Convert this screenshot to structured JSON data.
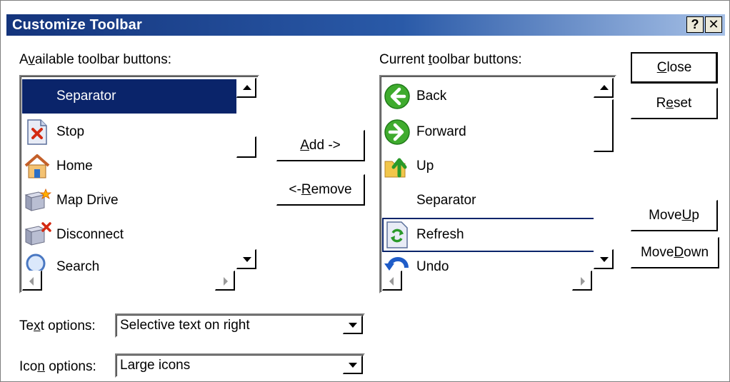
{
  "window": {
    "title": "Customize Toolbar",
    "help_label": "?",
    "close_label": "✕"
  },
  "available": {
    "label_pre": "A",
    "label_mnemonic": "v",
    "label_post": "ailable toolbar buttons:",
    "items": [
      {
        "label": "Separator",
        "icon": "none",
        "selected": true
      },
      {
        "label": "Stop",
        "icon": "stop-icon"
      },
      {
        "label": "Home",
        "icon": "home-icon"
      },
      {
        "label": "Map Drive",
        "icon": "map-drive-icon"
      },
      {
        "label": "Disconnect",
        "icon": "disconnect-icon"
      },
      {
        "label": "Search",
        "icon": "search-icon"
      }
    ]
  },
  "current": {
    "label_pre": "Current ",
    "label_mnemonic": "t",
    "label_post": "oolbar buttons:",
    "items": [
      {
        "label": "Back",
        "icon": "back-icon"
      },
      {
        "label": "Forward",
        "icon": "forward-icon"
      },
      {
        "label": "Up",
        "icon": "up-folder-icon"
      },
      {
        "label": "Separator",
        "icon": "none"
      },
      {
        "label": "Refresh",
        "icon": "refresh-icon",
        "focused": true
      },
      {
        "label": "Undo",
        "icon": "undo-icon"
      }
    ]
  },
  "buttons": {
    "add": {
      "mnemonic": "A",
      "rest": "dd ->"
    },
    "remove": {
      "pre": "<- ",
      "mnemonic": "R",
      "rest": "emove"
    },
    "close": {
      "mnemonic": "C",
      "rest": "lose"
    },
    "reset": {
      "pre": "R",
      "mnemonic": "e",
      "rest": "set"
    },
    "move_up": {
      "pre": "Move ",
      "mnemonic": "U",
      "rest": "p"
    },
    "move_down": {
      "pre": "Move ",
      "mnemonic": "D",
      "rest": "own"
    }
  },
  "text_options": {
    "label_pre": "Te",
    "label_mnemonic": "x",
    "label_post": "t options:",
    "value": "Selective text on right"
  },
  "icon_options": {
    "label_pre": "Ico",
    "label_mnemonic": "n",
    "label_post": " options:",
    "value": "Large icons"
  },
  "colors": {
    "selection": "#0a246a",
    "title_start": "#14347c",
    "title_end": "#a6c0e6"
  }
}
